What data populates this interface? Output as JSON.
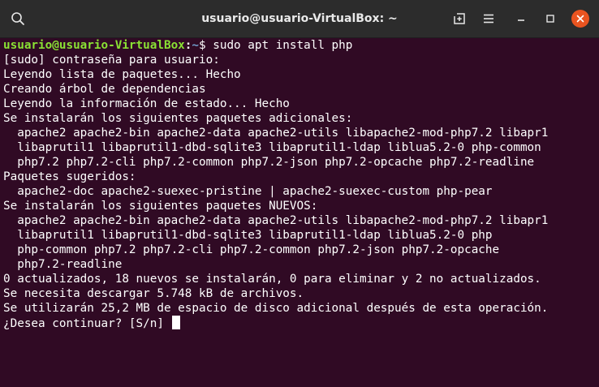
{
  "window": {
    "title": "usuario@usuario-VirtualBox: ~"
  },
  "titlebar_icons": {
    "search": "search-icon",
    "new_tab": "new-tab-icon",
    "menu": "hamburger-menu-icon",
    "minimize": "minimize-icon",
    "maximize": "maximize-icon",
    "close": "close-icon"
  },
  "colors": {
    "terminal_background": "#300a24",
    "titlebar_background": "#2c2c2c",
    "prompt_user": "#8ae234",
    "prompt_path": "#729fcf",
    "close_button": "#e95420"
  },
  "terminal": {
    "prompt": {
      "user_host": "usuario@usuario-VirtualBox",
      "separator": ":",
      "path": "~",
      "symbol": "$ ",
      "command": "sudo apt install php"
    },
    "output": [
      "[sudo] contraseña para usuario:",
      "Leyendo lista de paquetes... Hecho",
      "Creando árbol de dependencias",
      "Leyendo la información de estado... Hecho",
      "Se instalarán los siguientes paquetes adicionales:",
      "  apache2 apache2-bin apache2-data apache2-utils libapache2-mod-php7.2 libapr1",
      "  libaprutil1 libaprutil1-dbd-sqlite3 libaprutil1-ldap liblua5.2-0 php-common",
      "  php7.2 php7.2-cli php7.2-common php7.2-json php7.2-opcache php7.2-readline",
      "Paquetes sugeridos:",
      "  apache2-doc apache2-suexec-pristine | apache2-suexec-custom php-pear",
      "Se instalarán los siguientes paquetes NUEVOS:",
      "  apache2 apache2-bin apache2-data apache2-utils libapache2-mod-php7.2 libapr1",
      "  libaprutil1 libaprutil1-dbd-sqlite3 libaprutil1-ldap liblua5.2-0 php",
      "  php-common php7.2 php7.2-cli php7.2-common php7.2-json php7.2-opcache",
      "  php7.2-readline",
      "0 actualizados, 18 nuevos se instalarán, 0 para eliminar y 2 no actualizados.",
      "Se necesita descargar 5.748 kB de archivos.",
      "Se utilizarán 25,2 MB de espacio de disco adicional después de esta operación."
    ],
    "question": "¿Desea continuar? [S/n] "
  }
}
